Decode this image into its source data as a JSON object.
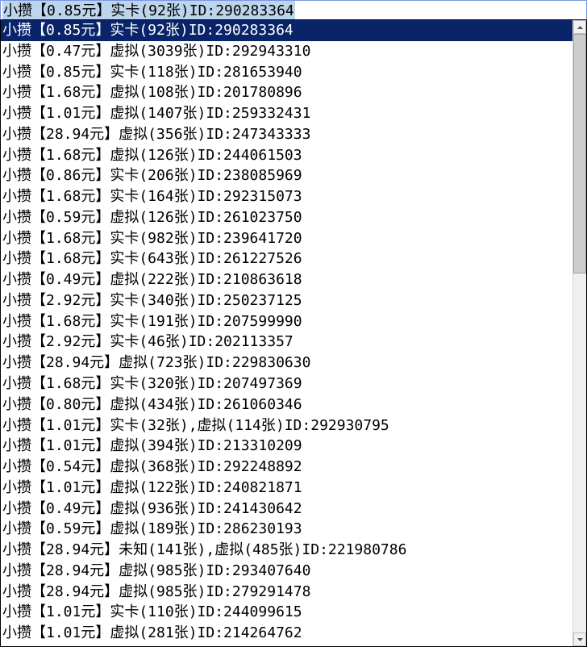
{
  "combo": {
    "field_value": "小攒【0.85元】实卡(92张)ID:290283364",
    "selected_index": 0,
    "items": [
      "小攒【0.85元】实卡(92张)ID:290283364",
      "小攒【0.47元】虚拟(3039张)ID:292943310",
      "小攒【0.85元】实卡(118张)ID:281653940",
      "小攒【1.68元】虚拟(108张)ID:201780896",
      "小攒【1.01元】虚拟(1407张)ID:259332431",
      "小攒【28.94元】虚拟(356张)ID:247343333",
      "小攒【1.68元】虚拟(126张)ID:244061503",
      "小攒【0.86元】实卡(206张)ID:238085969",
      "小攒【1.68元】实卡(164张)ID:292315073",
      "小攒【0.59元】虚拟(126张)ID:261023750",
      "小攒【1.68元】实卡(982张)ID:239641720",
      "小攒【1.68元】实卡(643张)ID:261227526",
      "小攒【0.49元】虚拟(222张)ID:210863618",
      "小攒【2.92元】实卡(340张)ID:250237125",
      "小攒【1.68元】实卡(191张)ID:207599990",
      "小攒【2.92元】实卡(46张)ID:202113357",
      "小攒【28.94元】虚拟(723张)ID:229830630",
      "小攒【1.68元】实卡(320张)ID:207497369",
      "小攒【0.80元】虚拟(434张)ID:261060346",
      "小攒【1.01元】实卡(32张),虚拟(114张)ID:292930795",
      "小攒【1.01元】虚拟(394张)ID:213310209",
      "小攒【0.54元】虚拟(368张)ID:292248892",
      "小攒【1.01元】虚拟(122张)ID:240821871",
      "小攒【0.49元】虚拟(936张)ID:241430642",
      "小攒【0.59元】虚拟(189张)ID:286230193",
      "小攒【28.94元】未知(141张),虚拟(485张)ID:221980786",
      "小攒【28.94元】虚拟(985张)ID:293407640",
      "小攒【28.94元】虚拟(985张)ID:279291478",
      "小攒【1.01元】实卡(110张)ID:244099615",
      "小攒【1.01元】虚拟(281张)ID:214264762"
    ]
  }
}
